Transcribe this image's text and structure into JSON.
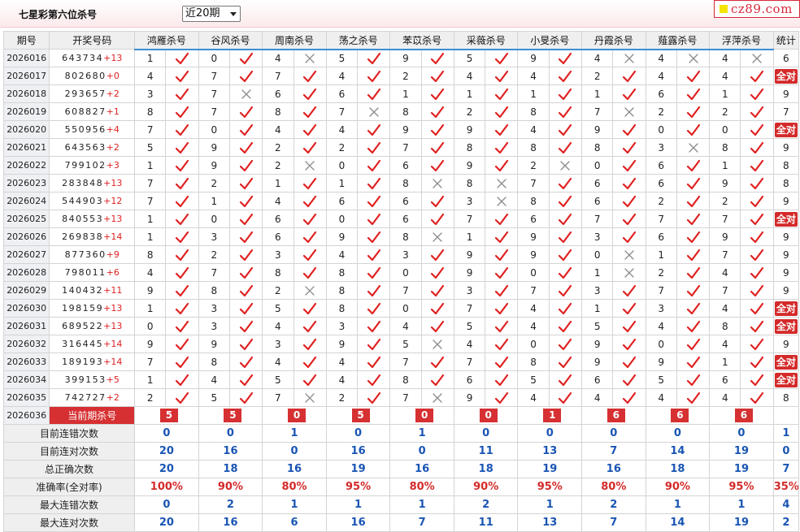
{
  "header": {
    "title": "七星彩第六位杀号",
    "range_selected": "近20期",
    "logo": "cz89.com"
  },
  "columns": {
    "period": "期号",
    "draw": "开奖号码",
    "experts": [
      "鸿雁杀号",
      "谷风杀号",
      "周南杀号",
      "荡之杀号",
      "苯苡杀号",
      "采薇杀号",
      "小旻杀号",
      "丹霞杀号",
      "薤露杀号",
      "浮萍杀号"
    ],
    "stat": "统计"
  },
  "rows": [
    {
      "period": "2026016",
      "digits": "643734",
      "plus": "+13",
      "kills": [
        1,
        0,
        4,
        5,
        9,
        5,
        9,
        4,
        4,
        4
      ],
      "ok": [
        1,
        1,
        0,
        1,
        1,
        1,
        1,
        0,
        0,
        0
      ],
      "stat": "6"
    },
    {
      "period": "2026017",
      "digits": "802680",
      "plus": "+0",
      "kills": [
        4,
        7,
        7,
        4,
        2,
        4,
        4,
        2,
        4,
        4
      ],
      "ok": [
        1,
        1,
        1,
        1,
        1,
        1,
        1,
        1,
        1,
        1
      ],
      "stat": "全对"
    },
    {
      "period": "2026018",
      "digits": "293657",
      "plus": "+2",
      "kills": [
        3,
        7,
        6,
        6,
        1,
        1,
        1,
        1,
        6,
        1
      ],
      "ok": [
        1,
        0,
        1,
        1,
        1,
        1,
        1,
        1,
        1,
        1
      ],
      "stat": "9"
    },
    {
      "period": "2026019",
      "digits": "608827",
      "plus": "+1",
      "kills": [
        8,
        7,
        8,
        7,
        8,
        2,
        8,
        7,
        2,
        2
      ],
      "ok": [
        1,
        1,
        1,
        0,
        1,
        1,
        1,
        0,
        1,
        1
      ],
      "stat": "7"
    },
    {
      "period": "2026020",
      "digits": "550956",
      "plus": "+4",
      "kills": [
        7,
        0,
        4,
        4,
        9,
        9,
        4,
        9,
        0,
        0
      ],
      "ok": [
        1,
        1,
        1,
        1,
        1,
        1,
        1,
        1,
        1,
        1
      ],
      "stat": "全对"
    },
    {
      "period": "2026021",
      "digits": "643563",
      "plus": "+2",
      "kills": [
        5,
        9,
        2,
        2,
        7,
        8,
        8,
        8,
        3,
        8
      ],
      "ok": [
        1,
        1,
        1,
        1,
        1,
        1,
        1,
        1,
        0,
        1
      ],
      "stat": "9"
    },
    {
      "period": "2026022",
      "digits": "799102",
      "plus": "+3",
      "kills": [
        1,
        9,
        2,
        0,
        6,
        9,
        2,
        0,
        6,
        1
      ],
      "ok": [
        1,
        1,
        0,
        1,
        1,
        1,
        0,
        1,
        1,
        1
      ],
      "stat": "8"
    },
    {
      "period": "2026023",
      "digits": "283848",
      "plus": "+13",
      "kills": [
        7,
        2,
        1,
        1,
        8,
        8,
        7,
        6,
        6,
        9
      ],
      "ok": [
        1,
        1,
        1,
        1,
        0,
        0,
        1,
        1,
        1,
        1
      ],
      "stat": "8"
    },
    {
      "period": "2026024",
      "digits": "544903",
      "plus": "+12",
      "kills": [
        7,
        1,
        4,
        6,
        6,
        3,
        8,
        6,
        2,
        2
      ],
      "ok": [
        1,
        1,
        1,
        1,
        1,
        0,
        1,
        1,
        1,
        1
      ],
      "stat": "9"
    },
    {
      "period": "2026025",
      "digits": "840553",
      "plus": "+13",
      "kills": [
        1,
        0,
        6,
        0,
        6,
        7,
        6,
        7,
        7,
        7
      ],
      "ok": [
        1,
        1,
        1,
        1,
        1,
        1,
        1,
        1,
        1,
        1
      ],
      "stat": "全对"
    },
    {
      "period": "2026026",
      "digits": "269838",
      "plus": "+14",
      "kills": [
        1,
        3,
        6,
        9,
        8,
        1,
        9,
        3,
        6,
        9
      ],
      "ok": [
        1,
        1,
        1,
        1,
        0,
        1,
        1,
        1,
        1,
        1
      ],
      "stat": "9"
    },
    {
      "period": "2026027",
      "digits": "877360",
      "plus": "+9",
      "kills": [
        8,
        2,
        3,
        4,
        3,
        9,
        9,
        0,
        1,
        7
      ],
      "ok": [
        1,
        1,
        1,
        1,
        1,
        1,
        1,
        0,
        1,
        1
      ],
      "stat": "9"
    },
    {
      "period": "2026028",
      "digits": "798011",
      "plus": "+6",
      "kills": [
        4,
        7,
        8,
        8,
        0,
        9,
        0,
        1,
        2,
        4
      ],
      "ok": [
        1,
        1,
        1,
        1,
        1,
        1,
        1,
        0,
        1,
        1
      ],
      "stat": "9"
    },
    {
      "period": "2026029",
      "digits": "140432",
      "plus": "+11",
      "kills": [
        9,
        8,
        2,
        8,
        7,
        3,
        7,
        3,
        7,
        7
      ],
      "ok": [
        1,
        1,
        0,
        1,
        1,
        1,
        1,
        1,
        1,
        1
      ],
      "stat": "9"
    },
    {
      "period": "2026030",
      "digits": "198159",
      "plus": "+13",
      "kills": [
        1,
        3,
        5,
        8,
        0,
        7,
        4,
        1,
        3,
        4
      ],
      "ok": [
        1,
        1,
        1,
        1,
        1,
        1,
        1,
        1,
        1,
        1
      ],
      "stat": "全对"
    },
    {
      "period": "2026031",
      "digits": "689522",
      "plus": "+13",
      "kills": [
        0,
        3,
        4,
        3,
        4,
        5,
        4,
        5,
        4,
        8
      ],
      "ok": [
        1,
        1,
        1,
        1,
        1,
        1,
        1,
        1,
        1,
        1
      ],
      "stat": "全对"
    },
    {
      "period": "2026032",
      "digits": "316445",
      "plus": "+14",
      "kills": [
        9,
        9,
        3,
        9,
        5,
        4,
        0,
        9,
        0,
        4
      ],
      "ok": [
        1,
        1,
        1,
        1,
        0,
        1,
        1,
        1,
        1,
        1
      ],
      "stat": "9"
    },
    {
      "period": "2026033",
      "digits": "189193",
      "plus": "+14",
      "kills": [
        7,
        8,
        4,
        4,
        7,
        7,
        8,
        9,
        9,
        1
      ],
      "ok": [
        1,
        1,
        1,
        1,
        1,
        1,
        1,
        1,
        1,
        1
      ],
      "stat": "全对"
    },
    {
      "period": "2026034",
      "digits": "399153",
      "plus": "+5",
      "kills": [
        1,
        4,
        5,
        4,
        8,
        6,
        5,
        6,
        5,
        6
      ],
      "ok": [
        1,
        1,
        1,
        1,
        1,
        1,
        1,
        1,
        1,
        1
      ],
      "stat": "全对"
    },
    {
      "period": "2026035",
      "digits": "742727",
      "plus": "+2",
      "kills": [
        2,
        5,
        7,
        2,
        7,
        9,
        4,
        4,
        4,
        4
      ],
      "ok": [
        1,
        1,
        0,
        1,
        0,
        1,
        1,
        1,
        1,
        1
      ],
      "stat": "8"
    }
  ],
  "current": {
    "period": "2026036",
    "label": "当前期杀号",
    "kills": [
      5,
      5,
      0,
      5,
      0,
      0,
      1,
      6,
      6,
      6
    ]
  },
  "summary": [
    {
      "label": "目前连错次数",
      "values": [
        "0",
        "0",
        "1",
        "0",
        "1",
        "0",
        "0",
        "0",
        "0",
        "0",
        "1"
      ]
    },
    {
      "label": "目前连对次数",
      "values": [
        "20",
        "16",
        "0",
        "16",
        "0",
        "11",
        "13",
        "7",
        "14",
        "19",
        "0"
      ]
    },
    {
      "label": "总正确次数",
      "values": [
        "20",
        "18",
        "16",
        "19",
        "16",
        "18",
        "19",
        "16",
        "18",
        "19",
        "7"
      ]
    },
    {
      "label": "准确率(全对率)",
      "values": [
        "100%",
        "90%",
        "80%",
        "95%",
        "80%",
        "90%",
        "95%",
        "80%",
        "90%",
        "95%",
        "35%"
      ],
      "red": true
    },
    {
      "label": "最大连错次数",
      "values": [
        "0",
        "2",
        "1",
        "1",
        "1",
        "2",
        "1",
        "2",
        "1",
        "1",
        "4"
      ]
    },
    {
      "label": "最大连对次数",
      "values": [
        "20",
        "16",
        "6",
        "16",
        "7",
        "11",
        "13",
        "7",
        "14",
        "19",
        "2"
      ]
    }
  ]
}
